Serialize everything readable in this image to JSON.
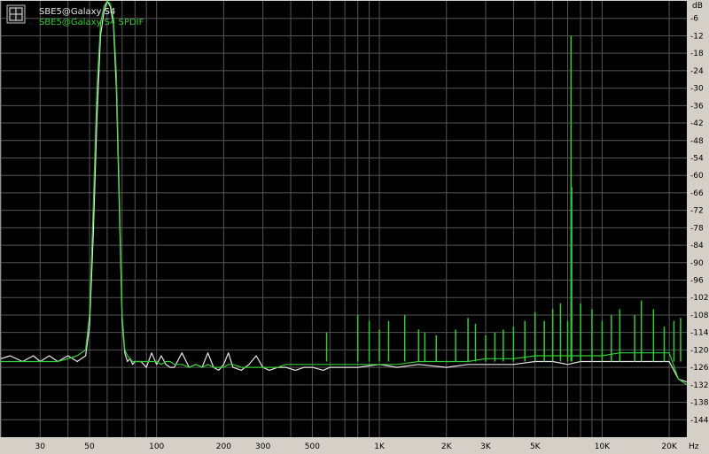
{
  "chart_data": {
    "type": "line",
    "x_scale": "log",
    "x_unit": "Hz",
    "y_unit": "dB",
    "xlim": [
      20,
      24000
    ],
    "ylim": [
      -150,
      0
    ],
    "grid": true,
    "legend_position": "top-left",
    "x_tick_labels": [
      {
        "value": 30,
        "label": "30"
      },
      {
        "value": 50,
        "label": "50"
      },
      {
        "value": 100,
        "label": "100"
      },
      {
        "value": 200,
        "label": "200"
      },
      {
        "value": 300,
        "label": "300"
      },
      {
        "value": 500,
        "label": "500"
      },
      {
        "value": 1000,
        "label": "1K"
      },
      {
        "value": 2000,
        "label": "2K"
      },
      {
        "value": 3000,
        "label": "3K"
      },
      {
        "value": 5000,
        "label": "5K"
      },
      {
        "value": 10000,
        "label": "10K"
      },
      {
        "value": 20000,
        "label": "20K"
      }
    ],
    "y_tick_labels": [
      -6,
      -12,
      -18,
      -24,
      -30,
      -36,
      -42,
      -48,
      -54,
      -60,
      -66,
      -72,
      -78,
      -84,
      -90,
      -96,
      -102,
      -108,
      -114,
      -120,
      -126,
      -132,
      -138,
      -144
    ],
    "colors": {
      "background": "#000000",
      "grid": "#555555",
      "frame": "#d4d0c8",
      "series_1": "#e6e6e6",
      "series_2": "#33cc33"
    },
    "series": [
      {
        "name": "SBE5@Galaxy S4",
        "color": "#e6e6e6",
        "x": [
          20,
          22,
          25,
          28,
          30,
          33,
          36,
          40,
          44,
          48,
          50,
          52,
          54,
          56,
          58,
          60,
          62,
          64,
          66,
          68,
          70,
          72,
          74,
          76,
          78,
          80,
          85,
          90,
          95,
          100,
          105,
          110,
          115,
          120,
          130,
          140,
          150,
          160,
          170,
          180,
          190,
          200,
          210,
          220,
          240,
          260,
          280,
          300,
          320,
          350,
          380,
          420,
          460,
          500,
          560,
          600,
          700,
          800,
          1000,
          1200,
          1500,
          2000,
          2500,
          3000,
          4000,
          5000,
          6000,
          7000,
          8000,
          10000,
          12000,
          15000,
          18000,
          20000,
          22000,
          24000
        ],
        "y": [
          -123,
          -122,
          -124,
          -122,
          -124,
          -122,
          -124,
          -122,
          -124,
          -122,
          -112,
          -80,
          -40,
          -12,
          -4,
          0,
          -2,
          -8,
          -30,
          -70,
          -110,
          -121,
          -124,
          -123,
          -125,
          -124,
          -124,
          -126,
          -121,
          -125,
          -122,
          -125,
          -126,
          -126,
          -121,
          -126,
          -125,
          -126,
          -121,
          -126,
          -127,
          -125,
          -121,
          -126,
          -127,
          -125,
          -122,
          -126,
          -127,
          -126,
          -126,
          -127,
          -126,
          -126,
          -127,
          -126,
          -126,
          -126,
          -125,
          -126,
          -125,
          -126,
          -125,
          -125,
          -125,
          -124,
          -124,
          -125,
          -124,
          -124,
          -124,
          -124,
          -124,
          -124,
          -130,
          -131
        ]
      },
      {
        "name": "SBE5@Galaxy S4 SPDIF",
        "color": "#33cc33",
        "x": [
          20,
          22,
          25,
          28,
          30,
          33,
          36,
          40,
          44,
          48,
          50,
          52,
          54,
          56,
          58,
          60,
          62,
          64,
          66,
          68,
          70,
          72,
          74,
          76,
          78,
          80,
          85,
          90,
          95,
          100,
          105,
          110,
          115,
          120,
          130,
          140,
          150,
          160,
          170,
          180,
          190,
          200,
          210,
          220,
          240,
          260,
          280,
          300,
          320,
          350,
          380,
          420,
          460,
          500,
          560,
          600,
          700,
          800,
          1000,
          1200,
          1500,
          2000,
          2500,
          3000,
          4000,
          5000,
          6000,
          7000,
          7300,
          8000,
          10000,
          12000,
          15000,
          18000,
          20000,
          22000,
          24000
        ],
        "y": [
          -124,
          -124,
          -124,
          -124,
          -124,
          -124,
          -124,
          -123,
          -122,
          -120,
          -108,
          -70,
          -30,
          -8,
          -2,
          0,
          -1,
          -6,
          -25,
          -65,
          -108,
          -120,
          -122,
          -123,
          -124,
          -124,
          -124,
          -124,
          -124,
          -124,
          -125,
          -124,
          -124,
          -125,
          -125,
          -126,
          -125,
          -126,
          -125,
          -126,
          -126,
          -126,
          -125,
          -125,
          -126,
          -126,
          -126,
          -126,
          -126,
          -126,
          -125,
          -125,
          -125,
          -125,
          -125,
          -125,
          -125,
          -125,
          -125,
          -125,
          -124,
          -124,
          -124,
          -123,
          -123,
          -122,
          -122,
          -122,
          -122,
          -122,
          -122,
          -121,
          -121,
          -121,
          -121,
          -130,
          -132
        ]
      }
    ],
    "spurs": [
      {
        "x": 7250,
        "y": -12
      },
      {
        "x": 7300,
        "y": -64
      },
      {
        "x": 580,
        "y": -114
      },
      {
        "x": 800,
        "y": -108
      },
      {
        "x": 900,
        "y": -110
      },
      {
        "x": 1000,
        "y": -113
      },
      {
        "x": 1100,
        "y": -110
      },
      {
        "x": 1300,
        "y": -108
      },
      {
        "x": 1500,
        "y": -113
      },
      {
        "x": 1600,
        "y": -114
      },
      {
        "x": 1800,
        "y": -115
      },
      {
        "x": 2200,
        "y": -113
      },
      {
        "x": 2500,
        "y": -109
      },
      {
        "x": 2700,
        "y": -111
      },
      {
        "x": 3000,
        "y": -115
      },
      {
        "x": 3300,
        "y": -114
      },
      {
        "x": 3600,
        "y": -113
      },
      {
        "x": 4000,
        "y": -112
      },
      {
        "x": 4500,
        "y": -110
      },
      {
        "x": 5000,
        "y": -107
      },
      {
        "x": 5500,
        "y": -110
      },
      {
        "x": 6000,
        "y": -106
      },
      {
        "x": 6500,
        "y": -104
      },
      {
        "x": 7000,
        "y": -110
      },
      {
        "x": 8000,
        "y": -104
      },
      {
        "x": 9000,
        "y": -106
      },
      {
        "x": 10000,
        "y": -110
      },
      {
        "x": 11000,
        "y": -108
      },
      {
        "x": 12000,
        "y": -106
      },
      {
        "x": 14000,
        "y": -108
      },
      {
        "x": 15000,
        "y": -103
      },
      {
        "x": 17000,
        "y": -106
      },
      {
        "x": 19000,
        "y": -112
      },
      {
        "x": 21000,
        "y": -110
      },
      {
        "x": 22500,
        "y": -109
      }
    ]
  }
}
